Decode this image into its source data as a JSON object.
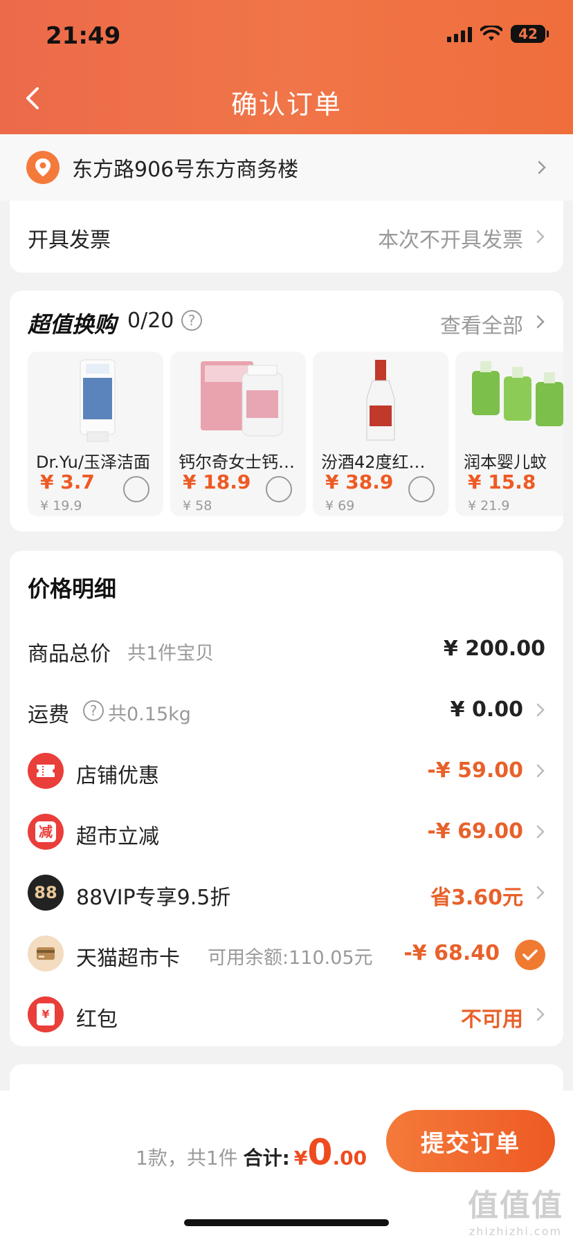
{
  "status_bar": {
    "time": "21:49",
    "battery": "42"
  },
  "header": {
    "title": "确认订单"
  },
  "address": {
    "text": "东方路906号东方商务楼"
  },
  "invoice": {
    "label": "开具发票",
    "value": "本次不开具发票"
  },
  "deals": {
    "title": "超值换购",
    "count": "0/20",
    "view_all": "查看全部",
    "items": [
      {
        "name": "Dr.Yu/玉泽洁面",
        "price": "¥ 3.7",
        "original": "¥ 19.9",
        "image": "cleanser-tube"
      },
      {
        "name": "钙尔奇女士钙…",
        "price": "¥ 18.9",
        "original": "¥ 58",
        "image": "calcium-bottle"
      },
      {
        "name": "汾酒42度红…",
        "price": "¥ 38.9",
        "original": "¥ 69",
        "image": "liquor-bottle"
      },
      {
        "name": "润本婴儿蚊",
        "price": "¥ 15.8",
        "original": "¥ 21.9",
        "image": "mosquito-repellent"
      }
    ]
  },
  "price_detail": {
    "title": "价格明细",
    "goods_total": {
      "label": "商品总价",
      "sub": "共1件宝贝",
      "value": "¥ 200.00"
    },
    "shipping": {
      "label": "运费",
      "sub": "共0.15kg",
      "value": "¥ 0.00"
    },
    "store_discount": {
      "label": "店铺优惠",
      "value": "-¥ 59.00",
      "icon": "ticket-icon"
    },
    "market_cut": {
      "label": "超市立减",
      "value": "-¥ 69.00",
      "icon": "reduce-icon",
      "icon_text": "减"
    },
    "vip": {
      "label": "88VIP专享9.5折",
      "value": "省3.60元",
      "icon_text": "88"
    },
    "tmall_card": {
      "label": "天猫超市卡",
      "sub": "可用余额:110.05元",
      "value": "-¥ 68.40",
      "checked": true
    },
    "red_packet": {
      "label": "红包",
      "value": "不可用",
      "icon_text": "¥"
    }
  },
  "bottom": {
    "count": "1款，共1件",
    "total_label": "合计:",
    "yen": "¥",
    "total_int": "0",
    "total_dec": ".00",
    "submit": "提交订单"
  },
  "watermark": {
    "main": "值值值",
    "sub": "zhizhizhi.com"
  },
  "colors": {
    "accent": "#ee5a24",
    "header": "#f07548"
  }
}
